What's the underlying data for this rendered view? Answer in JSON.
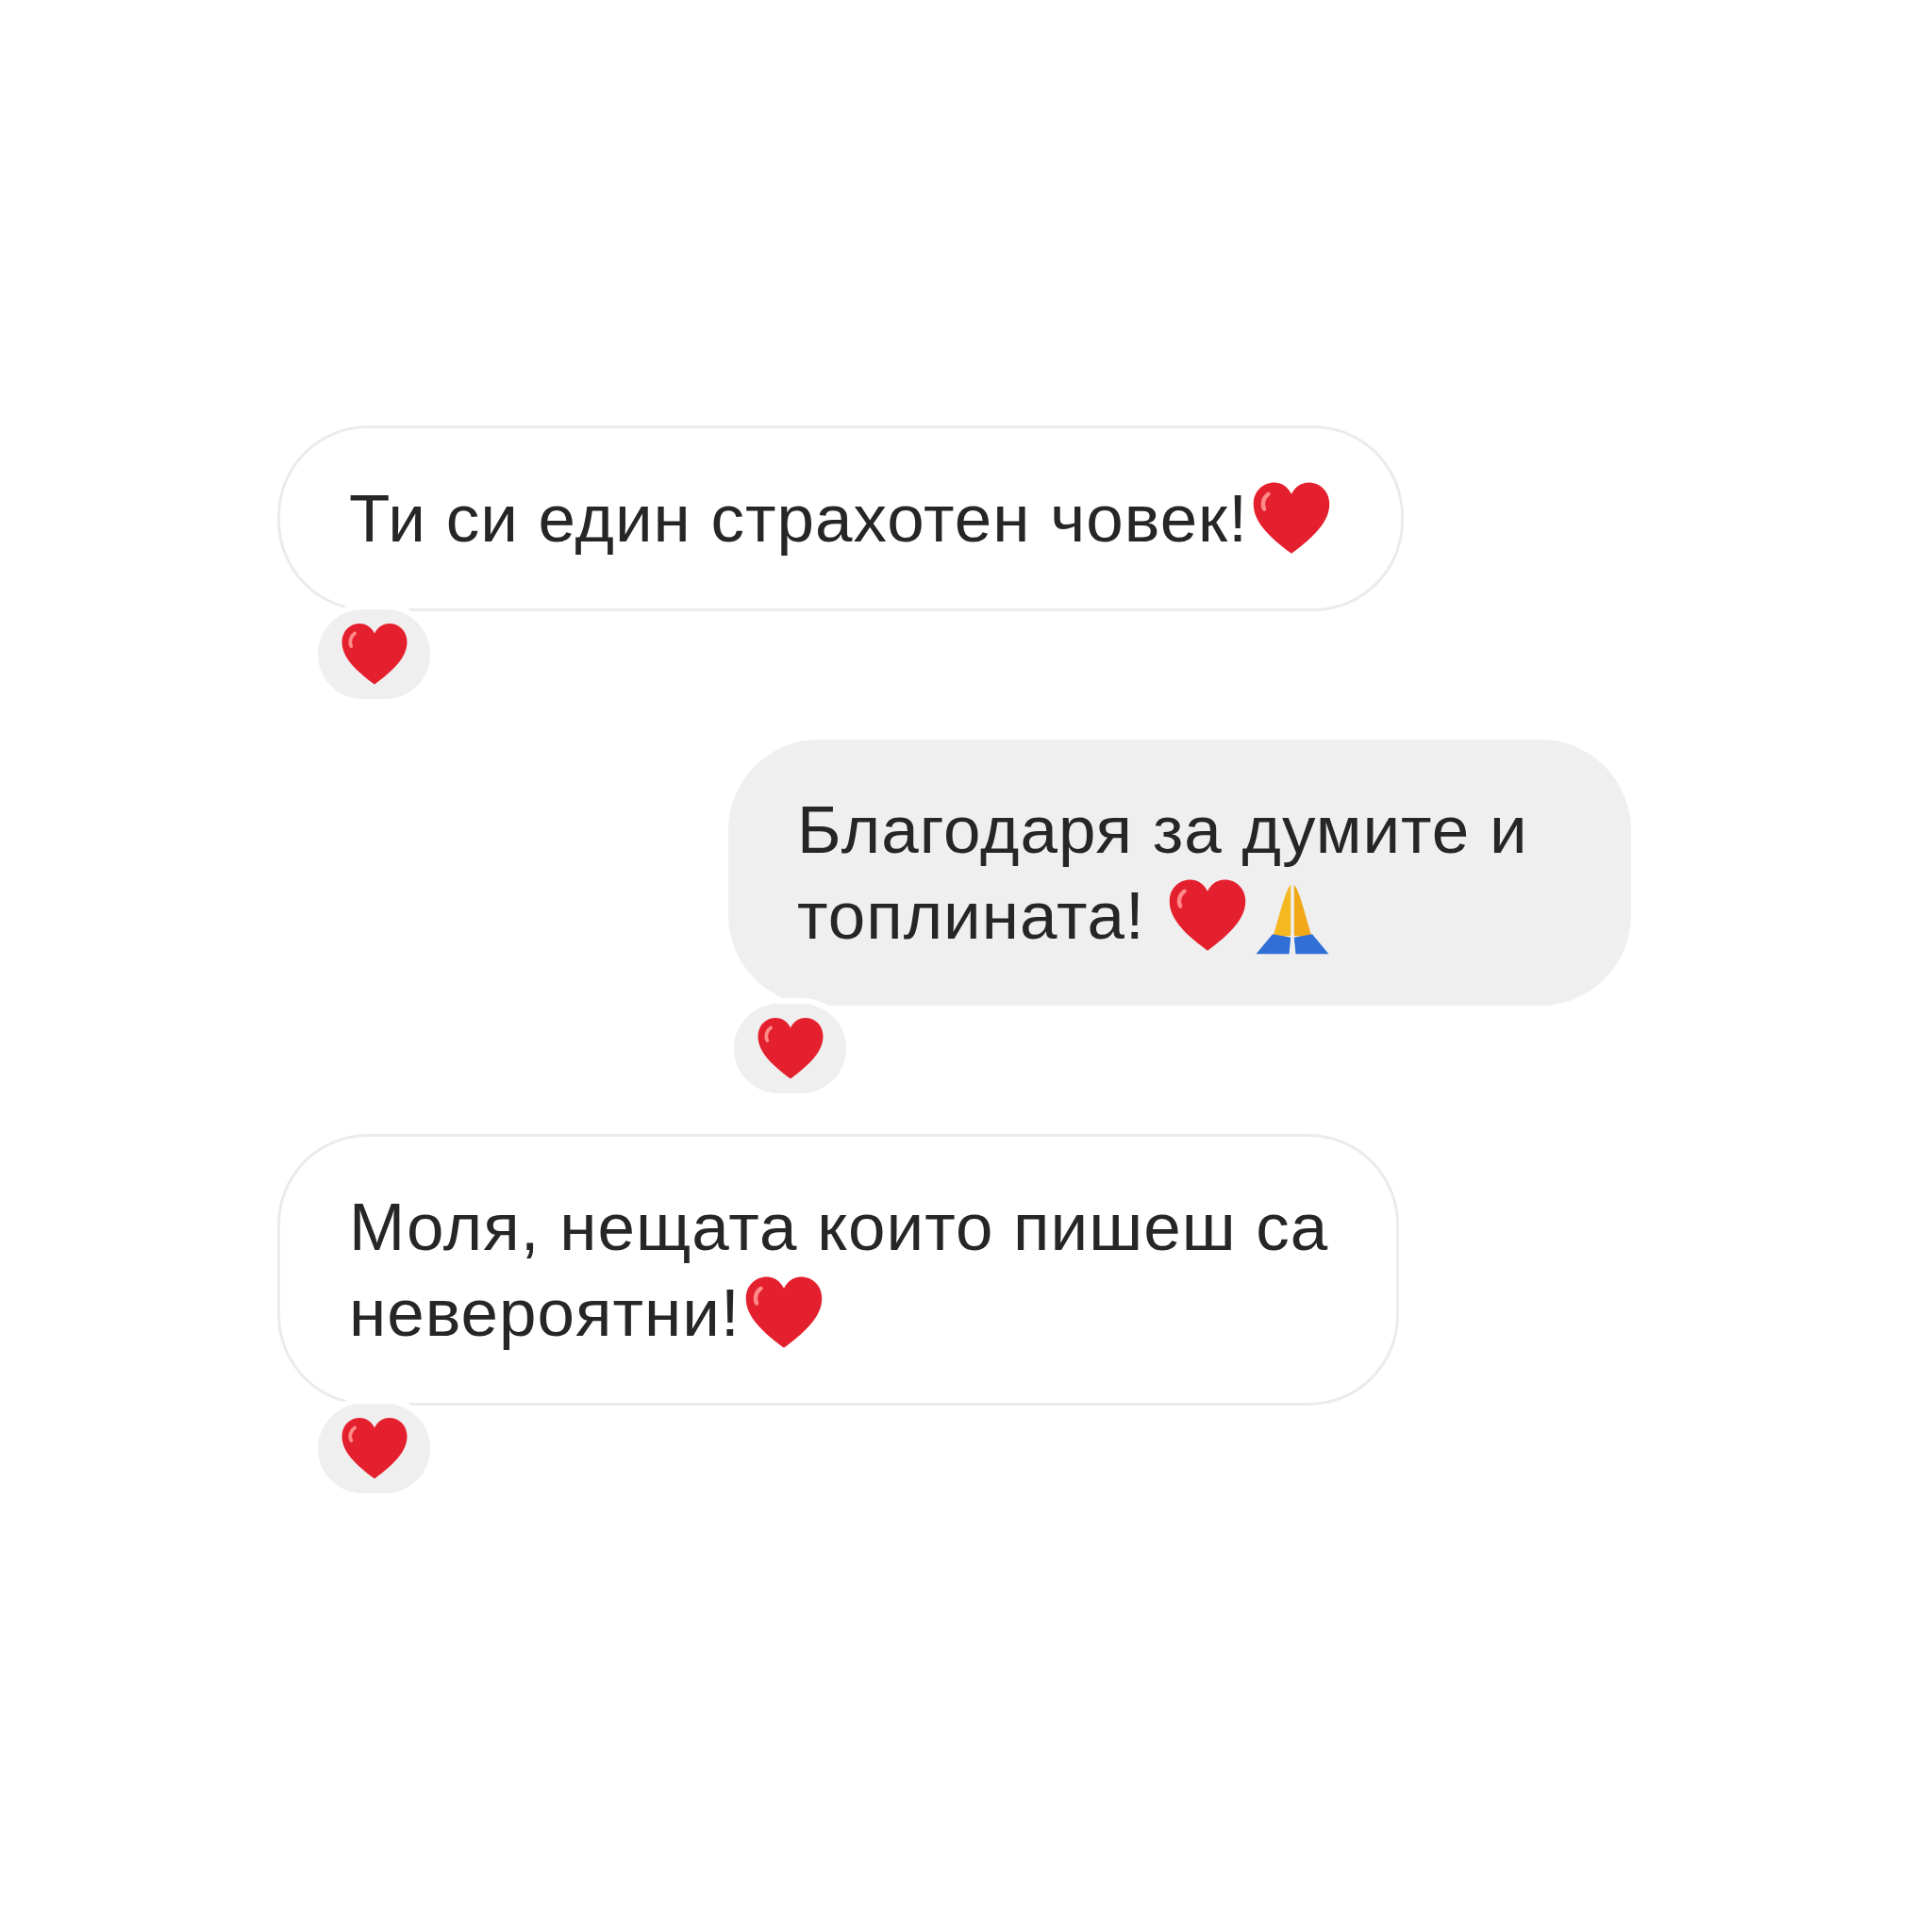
{
  "messages": [
    {
      "kind": "received",
      "lines": [
        "Ти си един страхотен човек!"
      ],
      "emojis": [
        {
          "kind": "heart"
        }
      ],
      "reaction": {
        "kind": "heart"
      }
    },
    {
      "kind": "sent",
      "lines": [
        "Благодаря за думите и",
        "топлината!"
      ],
      "emojis": [
        {
          "kind": "heart"
        },
        {
          "kind": "praying-hands"
        }
      ],
      "reaction": {
        "kind": "heart"
      }
    },
    {
      "kind": "received",
      "lines": [
        "Моля, нещата които пишеш са",
        "невероятни!"
      ],
      "emojis": [
        {
          "kind": "heart"
        }
      ],
      "reaction": {
        "kind": "heart"
      }
    }
  ]
}
